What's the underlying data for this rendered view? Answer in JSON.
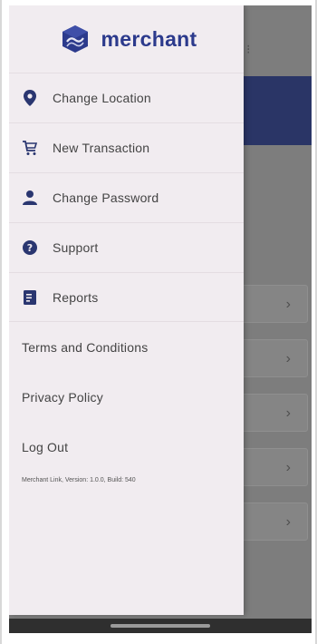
{
  "brand": {
    "name": "merchant"
  },
  "menu": [
    {
      "label": "Change Location",
      "icon": "location-pin-icon"
    },
    {
      "label": "New Transaction",
      "icon": "cart-icon"
    },
    {
      "label": "Change Password",
      "icon": "user-icon"
    },
    {
      "label": "Support",
      "icon": "question-circle-icon"
    },
    {
      "label": "Reports",
      "icon": "report-icon"
    }
  ],
  "links": [
    {
      "label": "Terms and Conditions"
    },
    {
      "label": "Privacy Policy"
    },
    {
      "label": "Log Out"
    }
  ],
  "version_text": "Merchant Link, Version: 1.0.0, Build: 540",
  "colors": {
    "brand": "#2c3a8c",
    "icon": "#2a3670",
    "drawer_bg": "#f1ecf0",
    "header_band": "#2a3566"
  }
}
